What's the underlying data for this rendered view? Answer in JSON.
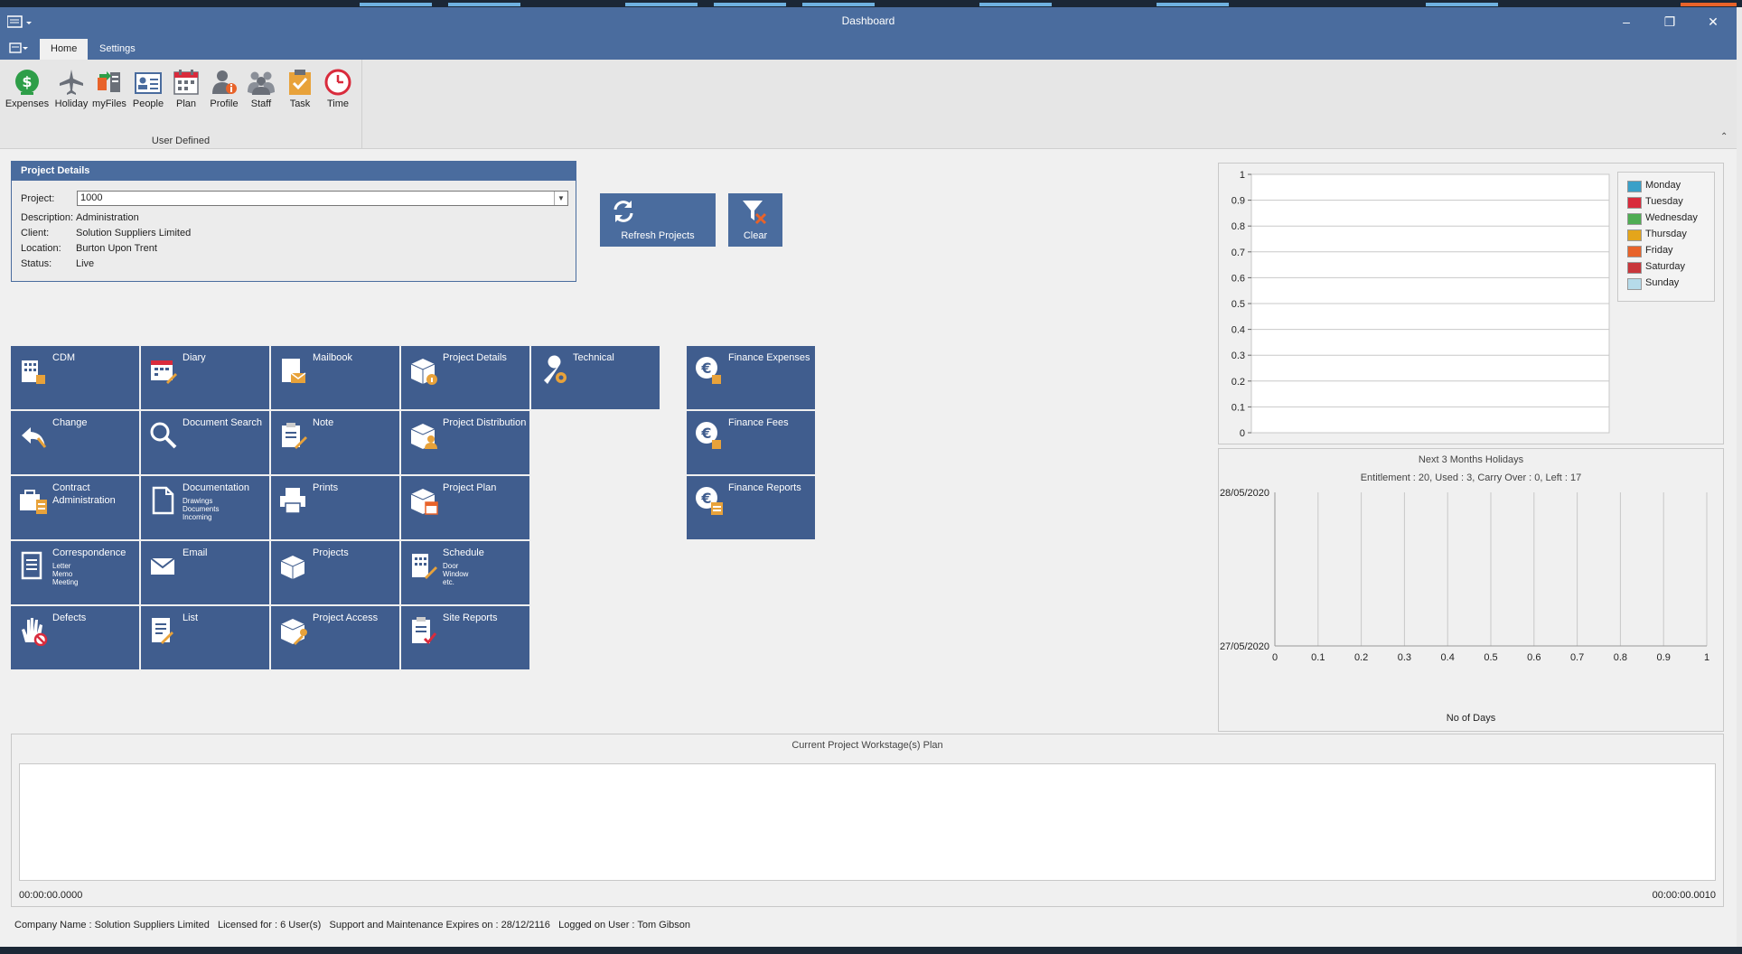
{
  "window": {
    "title": "Dashboard"
  },
  "ribbon": {
    "tabs": [
      {
        "label": "Home",
        "active": true
      },
      {
        "label": "Settings",
        "active": false
      }
    ],
    "buttons": [
      {
        "label": "Expenses",
        "icon": "dollar-coin-icon"
      },
      {
        "label": "Holiday",
        "icon": "airplane-icon"
      },
      {
        "label": "myFiles",
        "icon": "files-transfer-icon"
      },
      {
        "label": "People",
        "icon": "contact-card-icon"
      },
      {
        "label": "Plan",
        "icon": "calendar-icon"
      },
      {
        "label": "Profile",
        "icon": "user-info-icon"
      },
      {
        "label": "Staff",
        "icon": "group-icon"
      },
      {
        "label": "Task",
        "icon": "clipboard-check-icon"
      },
      {
        "label": "Time",
        "icon": "clock-icon"
      }
    ],
    "group_label": "User Defined"
  },
  "project_details": {
    "header": "Project Details",
    "labels": {
      "project": "Project:",
      "description": "Description:",
      "client": "Client:",
      "location": "Location:",
      "status": "Status:"
    },
    "project_value": "1000",
    "description": "Administration",
    "client": "Solution Suppliers Limited",
    "location": "Burton Upon Trent",
    "status": "Live"
  },
  "actions": {
    "refresh": "Refresh Projects",
    "clear": "Clear"
  },
  "tiles": [
    {
      "title": "CDM",
      "icon": "building-icon"
    },
    {
      "title": "Diary",
      "icon": "calendar-edit-icon"
    },
    {
      "title": "Mailbook",
      "icon": "mail-book-icon"
    },
    {
      "title": "Project Details",
      "icon": "box-info-icon"
    },
    {
      "title": "Technical",
      "icon": "wrench-gear-icon"
    },
    {
      "title": "Change",
      "icon": "undo-arrow-icon"
    },
    {
      "title": "Document Search",
      "icon": "magnifier-icon"
    },
    {
      "title": "Note",
      "icon": "note-pencil-icon"
    },
    {
      "title": "Project Distribution",
      "icon": "box-person-icon"
    },
    {
      "title": "Contract Administration",
      "icon": "briefcase-doc-icon"
    },
    {
      "title": "Documentation",
      "sub": [
        "Drawings",
        "Documents",
        "Incoming"
      ],
      "icon": "document-icon"
    },
    {
      "title": "Prints",
      "icon": "printer-icon"
    },
    {
      "title": "Project Plan",
      "icon": "box-calendar-icon"
    },
    {
      "title": "Correspondence",
      "sub": [
        "Letter",
        "Memo",
        "Meeting"
      ],
      "icon": "letter-icon"
    },
    {
      "title": "Email",
      "icon": "envelope-icon"
    },
    {
      "title": "Projects",
      "icon": "boxes-icon"
    },
    {
      "title": "Schedule",
      "sub": [
        "Door",
        "Window",
        "etc."
      ],
      "icon": "building-pencil-icon"
    },
    {
      "title": "Defects",
      "icon": "hand-stop-icon"
    },
    {
      "title": "List",
      "icon": "list-pencil-icon"
    },
    {
      "title": "Project Access",
      "icon": "box-key-icon"
    },
    {
      "title": "Site Reports",
      "icon": "clipboard-check-icon"
    }
  ],
  "finance_tiles": [
    {
      "title": "Finance Expenses",
      "icon": "euro-coin-icon"
    },
    {
      "title": "Finance Fees",
      "icon": "euro-coin-icon"
    },
    {
      "title": "Finance Reports",
      "icon": "euro-report-icon"
    }
  ],
  "chart_data": [
    {
      "type": "bar",
      "title": "",
      "ylim": [
        0,
        1
      ],
      "yticks": [
        "1",
        "0.9",
        "0.8",
        "0.7",
        "0.6",
        "0.5",
        "0.4",
        "0.3",
        "0.2",
        "0.1",
        "0"
      ],
      "grid": true,
      "legend_position": "right",
      "series": [
        {
          "name": "Monday",
          "color": "#3aa0c8",
          "values": []
        },
        {
          "name": "Tuesday",
          "color": "#d92b3c",
          "values": []
        },
        {
          "name": "Wednesday",
          "color": "#4fad53",
          "values": []
        },
        {
          "name": "Thursday",
          "color": "#e4a51b",
          "values": []
        },
        {
          "name": "Friday",
          "color": "#e8632a",
          "values": []
        },
        {
          "name": "Saturday",
          "color": "#c8363b",
          "values": []
        },
        {
          "name": "Sunday",
          "color": "#b6dbea",
          "values": []
        }
      ]
    },
    {
      "type": "bar",
      "title": "Next 3 Months Holidays",
      "subtitle": "Entitlement : 20, Used : 3, Carry Over : 0, Left : 17",
      "xlabel": "No of Days",
      "xlim": [
        0,
        1
      ],
      "xticks": [
        "0",
        "0.1",
        "0.2",
        "0.3",
        "0.4",
        "0.5",
        "0.6",
        "0.7",
        "0.8",
        "0.9",
        "1"
      ],
      "categories": [
        "28/05/2020",
        "27/05/2020"
      ],
      "values": [],
      "grid": true
    },
    {
      "type": "gantt",
      "title": "Current Project Workstage(s) Plan",
      "x_start_label": "00:00:00.0000",
      "x_end_label": "00:00:00.0010",
      "tasks": []
    }
  ],
  "status_bar": {
    "company": "Company Name : Solution Suppliers Limited",
    "licensed": "Licensed for : 6 User(s)",
    "support": "Support and Maintenance Expires on  : 28/12/2116",
    "user": "Logged on User : Tom Gibson"
  }
}
